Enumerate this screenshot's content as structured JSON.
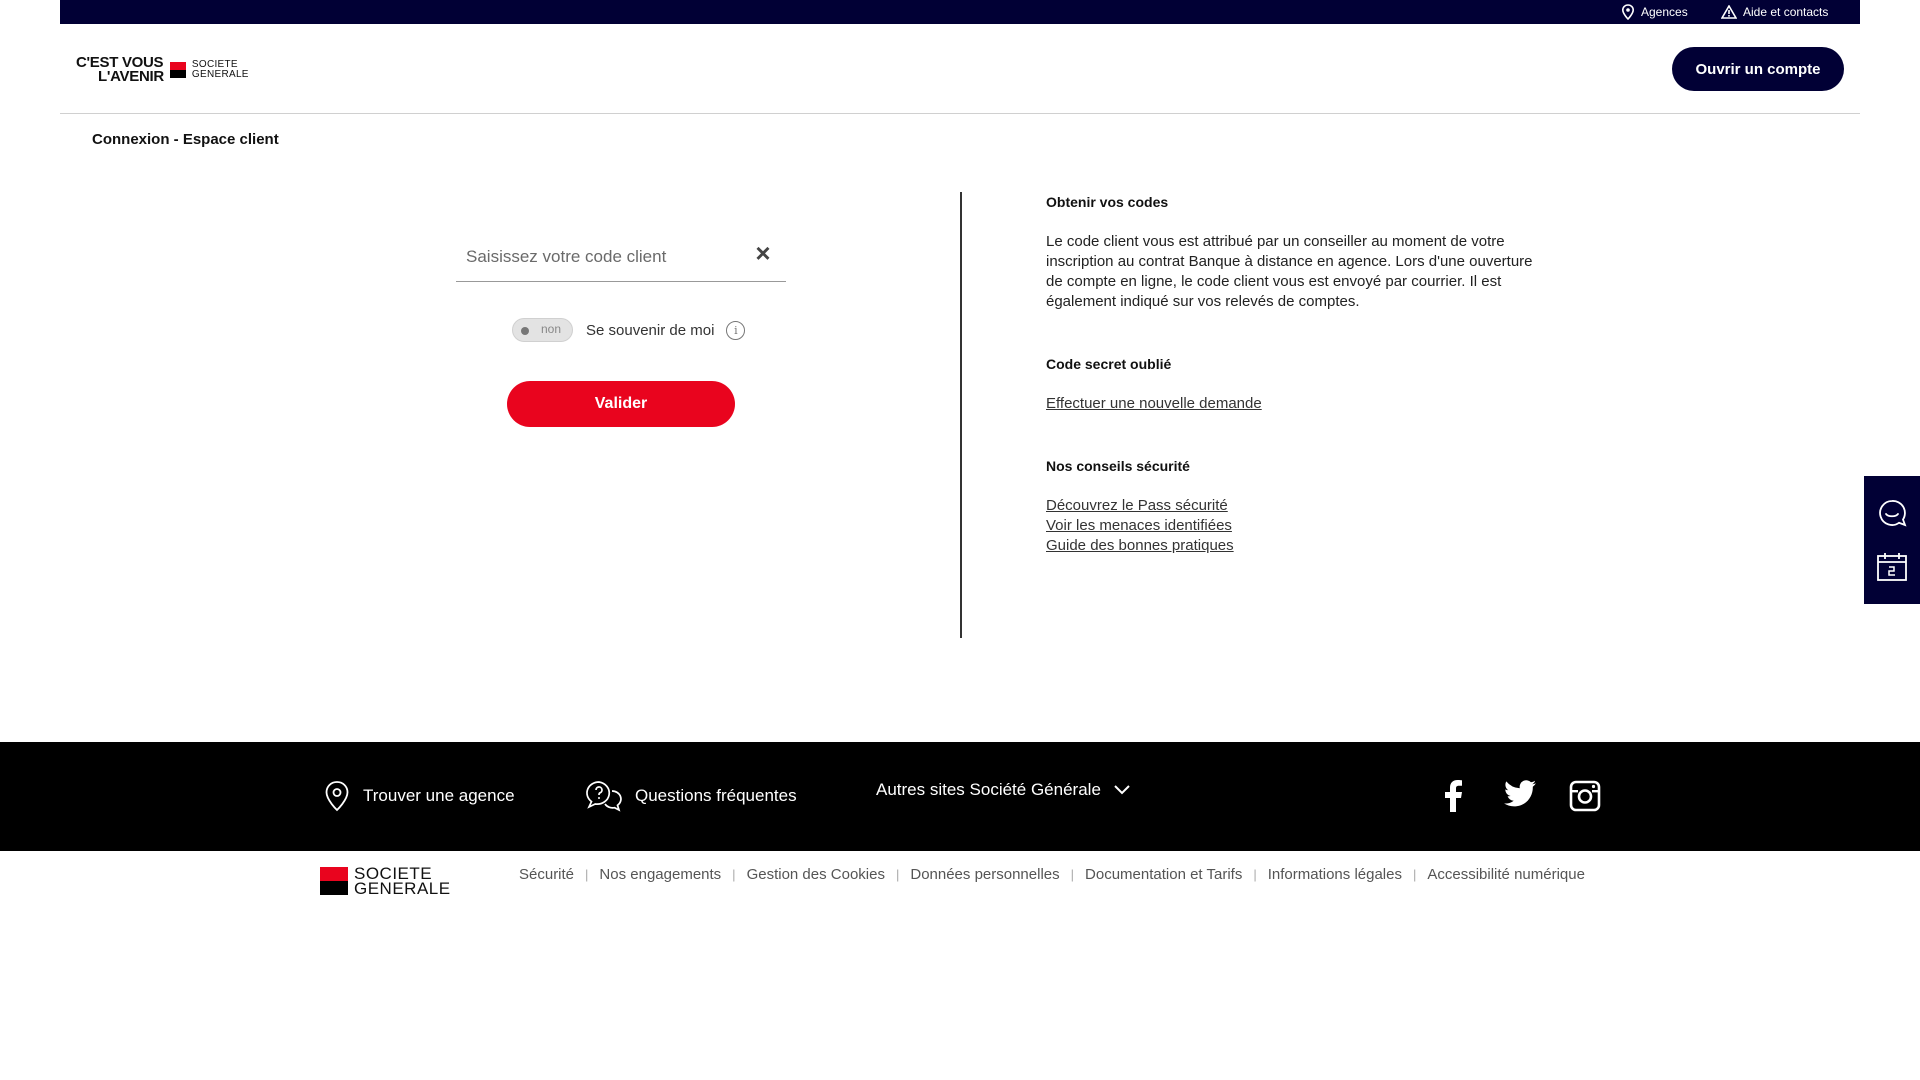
{
  "topbar": {
    "agencies_label": "Agences",
    "help_label": "Aide et contacts"
  },
  "header": {
    "slogan_line1": "C'EST VOUS",
    "slogan_line2": "L'AVENIR",
    "brand_line1": "SOCIETE",
    "brand_line2": "GENERALE",
    "open_account_label": "Ouvrir un compte"
  },
  "page": {
    "title": "Connexion - Espace client"
  },
  "login": {
    "client_code_placeholder": "Saisissez votre code client",
    "client_code_value": "",
    "clear_symbol": "×",
    "toggle_state": "non",
    "remember_label": "Se souvenir de moi",
    "info_symbol": "i",
    "validate_label": "Valider"
  },
  "info": {
    "codes_title": "Obtenir vos codes",
    "codes_text": "Le code client vous est attribué par un conseiller au moment de votre inscription au contrat Banque à distance en agence. Lors d'une ouverture de compte en ligne, le code client vous est envoyé par courrier. Il est également indiqué sur vos relevés de comptes.",
    "secret_title": "Code secret oublié",
    "secret_link": "Effectuer une nouvelle demande",
    "security_title": "Nos conseils sécurité",
    "security_links": [
      "Découvrez le Pass sécurité",
      "Voir les menaces identifiées",
      "Guide des bonnes pratiques"
    ]
  },
  "footer": {
    "find_agency": "Trouver une agence",
    "faq": "Questions fréquentes",
    "other_sites": "Autres sites Société Générale",
    "brand_line1": "SOCIETE",
    "brand_line2": "GENERALE",
    "legal_links": [
      "Sécurité",
      "Nos engagements",
      "Gestion des Cookies",
      "Données personnelles",
      "Documentation et Tarifs",
      "Informations légales",
      "Accessibilité numérique"
    ]
  },
  "colors": {
    "navy": "#010035",
    "red": "#e9041e",
    "black": "#000000"
  }
}
